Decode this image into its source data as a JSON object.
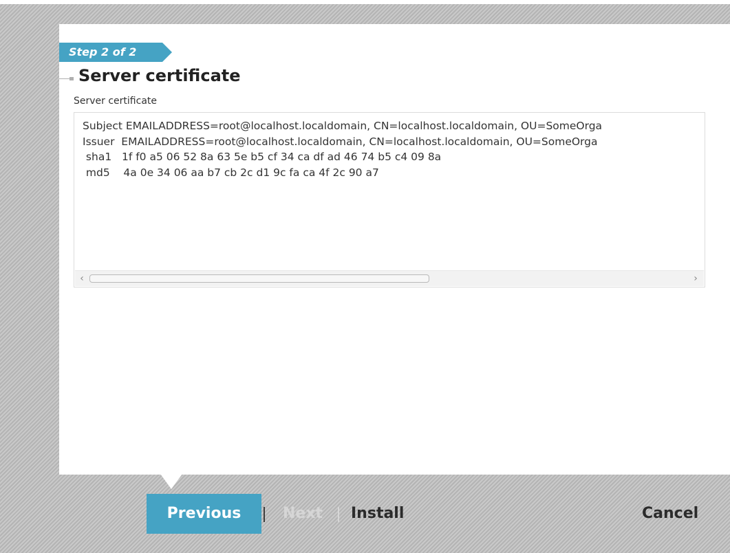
{
  "wizard": {
    "step_label": "Step 2 of 2",
    "title": "Server certificate",
    "field_label": "Server certificate"
  },
  "certificate": {
    "lines": [
      "Subject EMAILADDRESS=root@localhost.localdomain, CN=localhost.localdomain, OU=SomeOrga",
      "Issuer  EMAILADDRESS=root@localhost.localdomain, CN=localhost.localdomain, OU=SomeOrga",
      " sha1   1f f0 a5 06 52 8a 63 5e b5 cf 34 ca df ad 46 74 b5 c4 09 8a",
      " md5    4a 0e 34 06 aa b7 cb 2c d1 9c fa ca 4f 2c 90 a7"
    ],
    "scroll_left_icon": "chevron-left-icon",
    "scroll_right_icon": "chevron-right-icon"
  },
  "buttons": {
    "previous": "Previous",
    "next": "Next",
    "install": "Install",
    "cancel": "Cancel"
  },
  "colors": {
    "accent": "#45a3c4",
    "disabled_text": "#d6d6d6"
  }
}
